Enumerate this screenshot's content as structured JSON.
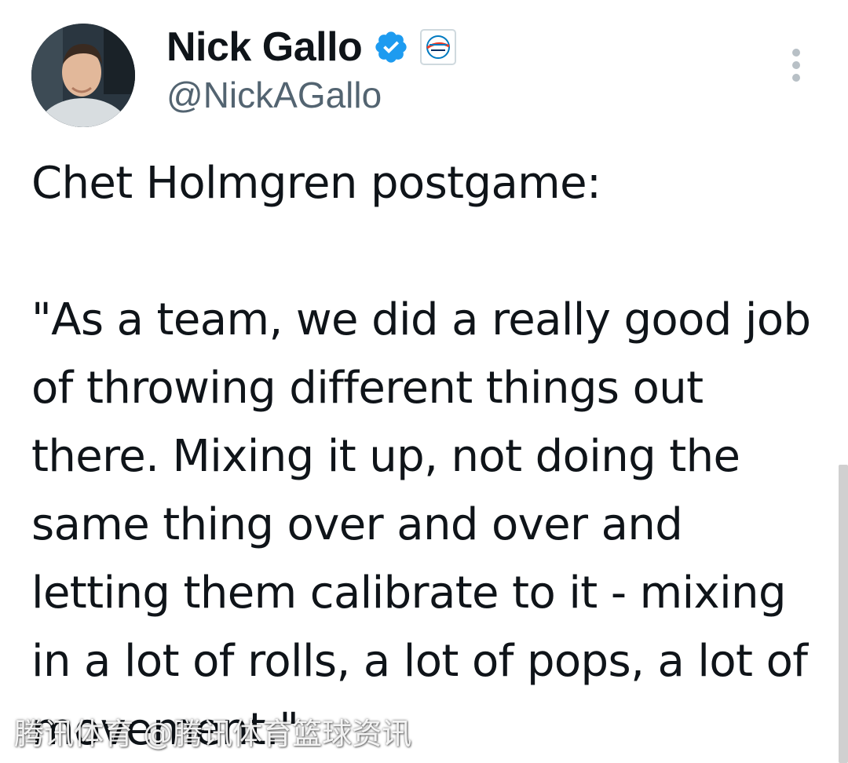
{
  "author": {
    "display_name": "Nick Gallo",
    "handle": "@NickAGallo",
    "verified_icon": "verified-badge-icon",
    "affiliate_icon": "team-logo-icon"
  },
  "tweet": {
    "text": "Chet Holmgren postgame:\n\n\"As a team, we did a really good job of throwing different things out there. Mixing it up, not doing the same thing over and over and letting them calibrate to it - mixing in a lot of rolls, a lot of pops, a lot of movement.\""
  },
  "menu": {
    "icon": "more-options-icon"
  },
  "watermark": {
    "text": "腾讯体育 @腾讯体育篮球资讯"
  },
  "colors": {
    "verified_blue": "#1d9bf0",
    "text_primary": "#0f1419",
    "text_secondary": "#536471"
  }
}
